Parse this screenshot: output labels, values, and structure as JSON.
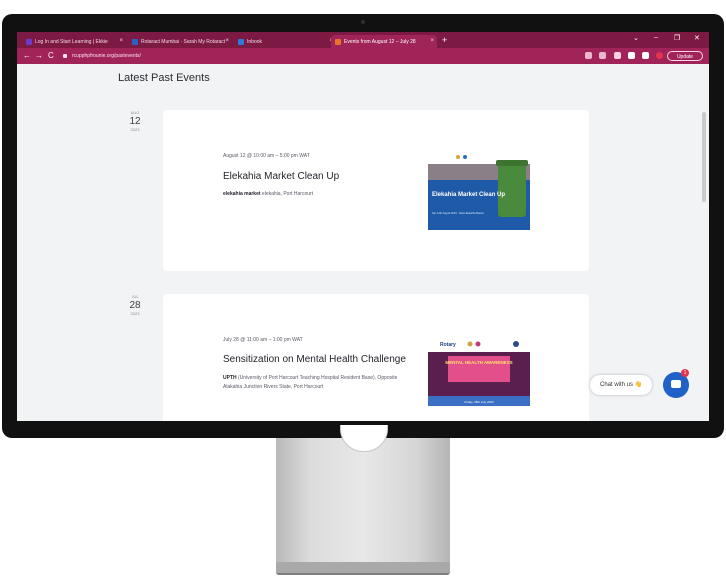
{
  "browser": {
    "tabs": [
      {
        "label": "Log In and Start Learning | Ekkie",
        "favicon": "#6a3cc9"
      },
      {
        "label": "Rotaract Mumbai · Sarah My Rotaract",
        "favicon": "#2a62c6"
      },
      {
        "label": "Inbook",
        "favicon": "#2f7ad6"
      },
      {
        "label": "Events from August 12 – July 28",
        "favicon": "#e8742a"
      }
    ],
    "new_tab": "+",
    "url": "rcupphpfrounie.org/pastevents/",
    "update_label": "Update",
    "window_controls": {
      "minimize": "–",
      "restore": "❐",
      "close": "✕"
    },
    "nav": {
      "back": "←",
      "forward": "→",
      "reload": "C"
    }
  },
  "page": {
    "title": "Latest Past Events",
    "events": [
      {
        "month": "AUG",
        "day": "12",
        "year": "2023",
        "time": "August 12 @ 10:00 am – 5:00 pm WAT",
        "title": "Elekahia Market Clean Up",
        "venue_name": "elekahia market",
        "venue_addr": "elekahia, Port Harcourt",
        "thumb_title": "Elekahia Market Clean Up",
        "thumb_sub": "Sat, 12th August 2023 · 10am Elekahia Market"
      },
      {
        "month": "JUL",
        "day": "28",
        "year": "2023",
        "time": "July 28 @ 11:00 am – 1:00 pm WAT",
        "title": "Sensitization on Mental Health Challenge",
        "venue_name": "UPTH",
        "venue_addr": "(University of Port Harcourt Teaching Hospital Resident Base), Opposite Alakahia Junction Rivers State, Port Harcourt",
        "thumb_logo": "Rotary",
        "thumb_title": "MENTAL HEALTH AWARENESS",
        "thumb_sub": "Friday, 28th July 2023"
      }
    ]
  },
  "chat": {
    "label": "Chat with us 👋",
    "badge": "1"
  }
}
